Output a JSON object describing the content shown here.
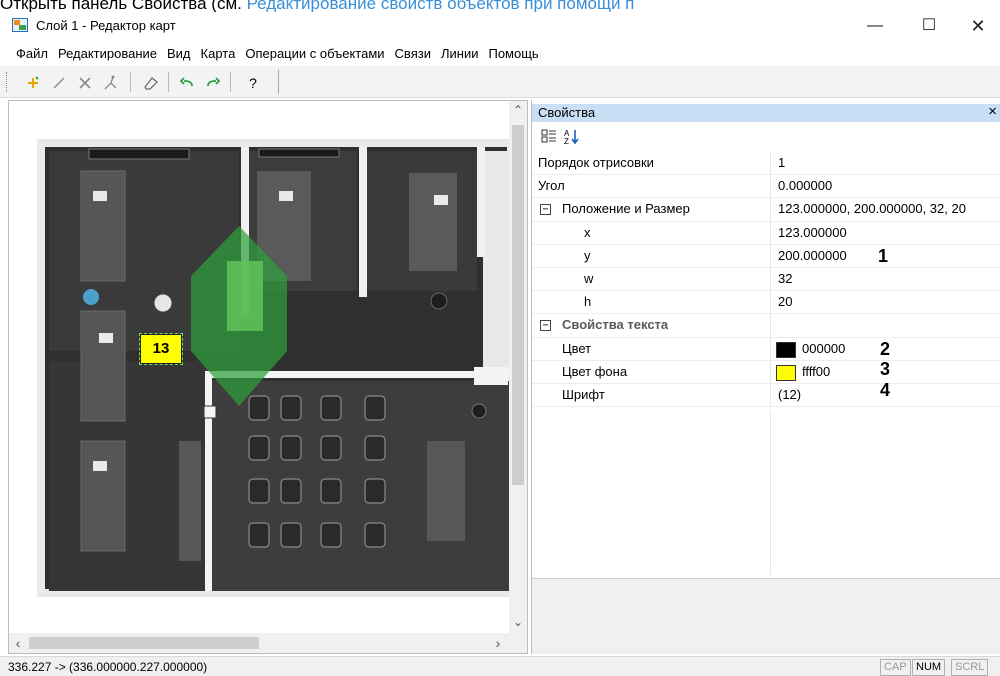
{
  "doc_caption": {
    "text": "Открыть панель Свойства (см. ",
    "link": "Редактирование свойств объектов при помощи п"
  },
  "window": {
    "title": "Слой 1 - Редактор карт",
    "minimize_glyph": "—",
    "maximize_glyph": "☐",
    "close_glyph": "✕"
  },
  "menu": [
    "Файл",
    "Редактирование",
    "Вид",
    "Карта",
    "Операции с объектами",
    "Связи",
    "Линии",
    "Помощь"
  ],
  "toolbar": {
    "icons": [
      "add-point-icon",
      "draw-line-icon",
      "delete-icon",
      "edit-vertex-icon",
      "eraser-icon",
      "undo-icon",
      "redo-icon",
      "help-icon"
    ],
    "help_label": "?"
  },
  "map": {
    "marker_label": "13",
    "marker_bg": "#ffff00"
  },
  "properties": {
    "title": "Свойства",
    "close_glyph": "×",
    "rows": [
      {
        "name": "Порядок отрисовки",
        "value": "1"
      },
      {
        "name": "Угол",
        "value": "0.000000"
      },
      {
        "name": "Положение и Размер",
        "value": "123.000000, 200.000000, 32, 20",
        "expander": "⊟"
      },
      {
        "name": "x",
        "value": "123.000000"
      },
      {
        "name": "y",
        "value": "200.000000",
        "annotation": "1"
      },
      {
        "name": "w",
        "value": "32"
      },
      {
        "name": "h",
        "value": "20"
      },
      {
        "name": "Свойства текста",
        "expander": "⊟"
      },
      {
        "name": "Цвет",
        "value": "000000",
        "swatch": "#000000",
        "annotation": "2"
      },
      {
        "name": "Цвет фона",
        "value": "ffff00",
        "swatch": "#ffff00",
        "annotation": "3"
      },
      {
        "name": "Шрифт",
        "value": "(12)",
        "annotation": "4"
      }
    ]
  },
  "status": {
    "text": "336.227 -> (336.000000.227.000000)",
    "indicators": [
      "CAP",
      "NUM",
      "SCRL"
    ]
  }
}
